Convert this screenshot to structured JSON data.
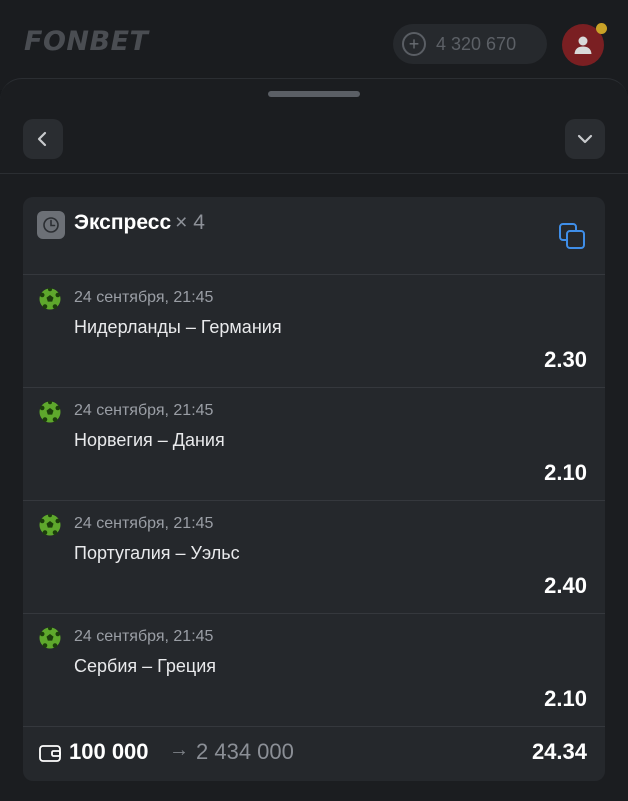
{
  "header": {
    "logo": "FONBET",
    "balance": "4 320 670"
  },
  "colors": {
    "background": "#17191c",
    "card": "#25282c",
    "ball_green": "#5ea82c",
    "avatar": "#7a1f22"
  },
  "icons": {
    "back": "chevron-left-icon",
    "collapse": "chevron-down-icon",
    "type": "clock-icon",
    "copy": "copy-icon",
    "sport": "soccer-ball-icon",
    "wallet": "wallet-icon"
  },
  "bet": {
    "type_label": "Экспресс",
    "multiplier": "× 4",
    "events": [
      {
        "date": "24 сентября, 21:45",
        "match": "Нидерланды – Германия",
        "odds": "2.30"
      },
      {
        "date": "24 сентября, 21:45",
        "match": "Норвегия – Дания",
        "odds": "2.10"
      },
      {
        "date": "24 сентября, 21:45",
        "match": "Португалия – Уэльс",
        "odds": "2.40"
      },
      {
        "date": "24 сентября, 21:45",
        "match": "Сербия – Греция",
        "odds": "2.10"
      }
    ],
    "stake": "100 000",
    "arrow": "→",
    "payout": "2 434 000",
    "total_odds": "24.34"
  }
}
